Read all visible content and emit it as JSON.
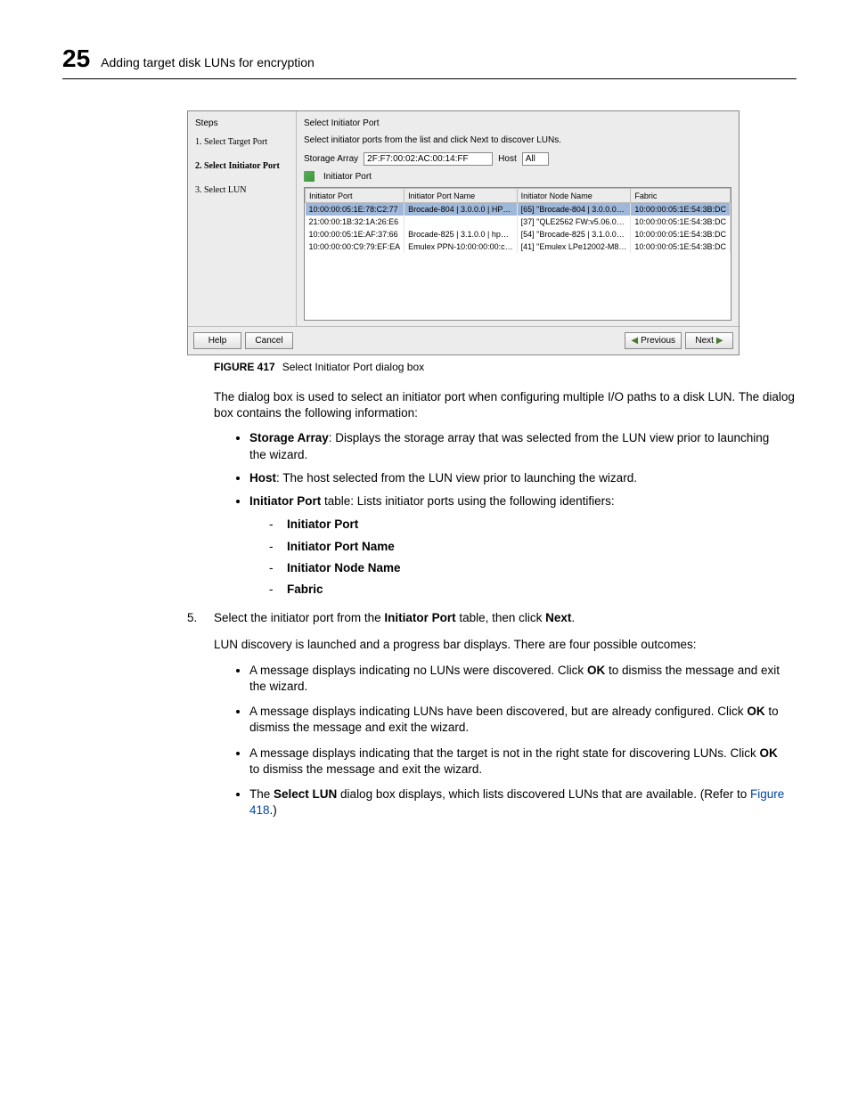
{
  "page": {
    "number": "25",
    "title": "Adding target disk LUNs for encryption"
  },
  "dialog": {
    "steps_heading": "Steps",
    "steps": [
      {
        "label": "1. Select Target Port"
      },
      {
        "label": "2. Select Initiator Port"
      },
      {
        "label": "3. Select LUN"
      }
    ],
    "main_heading": "Select Initiator Port",
    "instruction": "Select initiator ports from the list and click Next to discover LUNs.",
    "storage_array_label": "Storage Array",
    "storage_array_value": "2F:F7:00:02:AC:00:14:FF",
    "host_label": "Host",
    "host_value": "All",
    "initiator_port_label": "Initiator Port",
    "columns": {
      "c1": "Initiator Port",
      "c2": "Initiator Port Name",
      "c3": "Initiator Node Name",
      "c4": "Fabric"
    },
    "rows": [
      {
        "c1": "10:00:00:05:1E:78:C2:77",
        "c2": "Brocade-804 | 3.0.0.0 | HP…",
        "c3": "[65] \"Brocade-804 | 3.0.0.0…",
        "c4": "10:00:00:05:1E:54:3B:DC"
      },
      {
        "c1": "21:00:00:1B:32:1A:26:E6",
        "c2": "",
        "c3": "[37] \"QLE2562 FW:v5.06.0…",
        "c4": "10:00:00:05:1E:54:3B:DC"
      },
      {
        "c1": "10:00:00:05:1E:AF:37:66",
        "c2": "Brocade-825 | 3.1.0.0 | hp…",
        "c3": "[54] \"Brocade-825 | 3.1.0.0…",
        "c4": "10:00:00:05:1E:54:3B:DC"
      },
      {
        "c1": "10:00:00:00:C9:79:EF:EA",
        "c2": "Emulex PPN-10:00:00:00:c…",
        "c3": "[41] \"Emulex LPe12002-M8…",
        "c4": "10:00:00:05:1E:54:3B:DC"
      }
    ],
    "buttons": {
      "help": "Help",
      "cancel": "Cancel",
      "previous": "Previous",
      "next": "Next"
    }
  },
  "caption": {
    "figure_label": "FIGURE 417",
    "text": "Select Initiator Port dialog box"
  },
  "prose": {
    "intro": "The dialog box is used to select an initiator port when configuring multiple I/O paths to a disk LUN. The dialog box contains the following information:",
    "b1_label": "Storage Array",
    "b1_rest": ": Displays the storage array that was selected from the LUN view prior to launching the wizard.",
    "b2_label": "Host",
    "b2_rest": ": The host selected from the LUN view prior to launching the wizard.",
    "b3_label": "Initiator Port",
    "b3_rest": " table: Lists initiator ports using the following identifiers:",
    "sub": {
      "s1": "Initiator Port",
      "s2": "Initiator Port Name",
      "s3": "Initiator Node Name",
      "s4": "Fabric"
    },
    "step5_pre": "Select the initiator port from the ",
    "step5_mid": "Initiator Port",
    "step5_post1": " table, then click ",
    "step5_bold2": "Next",
    "step5_end": ".",
    "after5": "LUN discovery is launched and a progress bar displays. There are four possible outcomes:",
    "o1_a": "A message displays indicating no LUNs were discovered. Click ",
    "o1_b": "OK",
    "o1_c": " to dismiss the message and exit the wizard.",
    "o2_a": "A message displays indicating LUNs have been discovered, but are already configured. Click ",
    "o2_b": "OK",
    "o2_c": " to dismiss the message and exit the wizard.",
    "o3_a": "A message displays indicating that the target is not in the right state for discovering LUNs. Click ",
    "o3_b": "OK",
    "o3_c": " to dismiss the message and exit the wizard.",
    "o4_a": "The ",
    "o4_b": "Select LUN",
    "o4_c": " dialog box displays, which lists discovered LUNs that are available. (Refer to ",
    "o4_ref": "Figure 418",
    "o4_d": ".)"
  }
}
